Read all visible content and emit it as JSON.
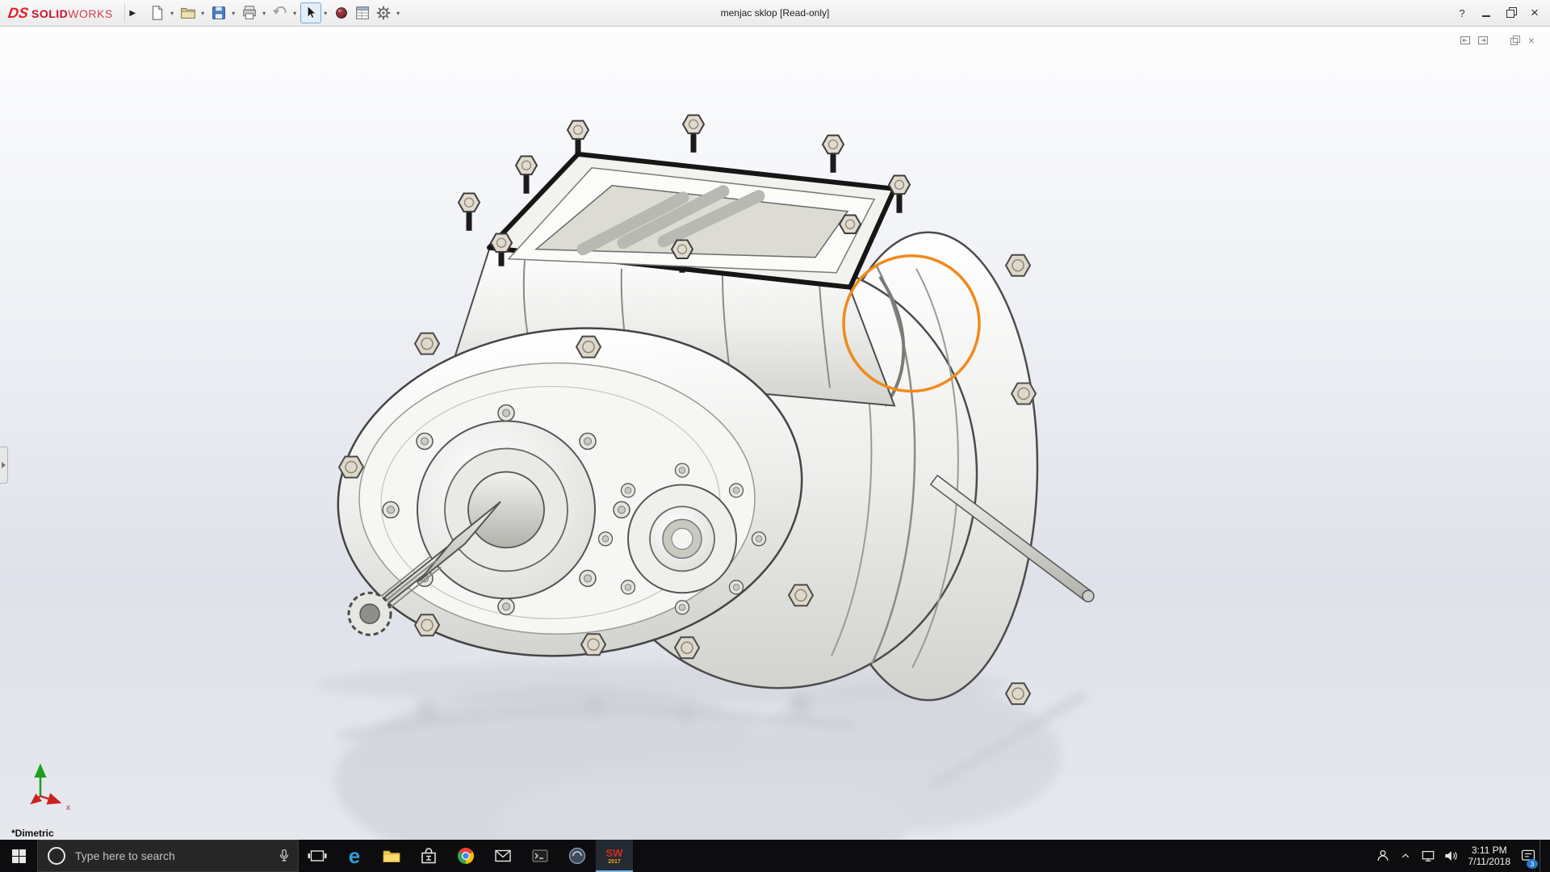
{
  "titlebar": {
    "logo_ds": "DS",
    "logo_solid": "SOLID",
    "logo_works": "WORKS",
    "title": "menjac sklop [Read-only]",
    "help": "?"
  },
  "icons": {
    "flyout": "▶",
    "dropdown": "▾",
    "close": "×",
    "doc_close": "×",
    "edge_letter": "e"
  },
  "viewport": {
    "orientation": "*Dimetric",
    "triad_x": "x"
  },
  "taskbar": {
    "search_placeholder": "Type here to search",
    "sw_label": "SW",
    "sw_year": "2017",
    "time": "3:11 PM",
    "date": "7/11/2018",
    "badge": "3"
  },
  "colors": {
    "annotation": "#ef8b1c"
  }
}
